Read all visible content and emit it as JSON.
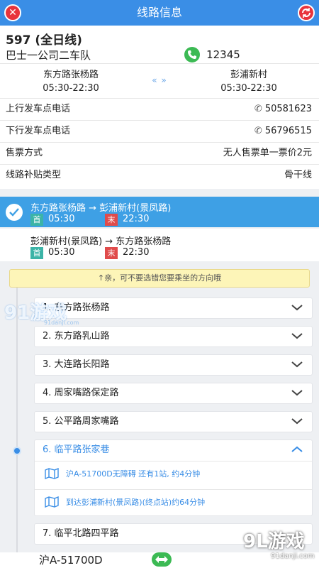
{
  "header": {
    "title": "线路信息"
  },
  "route": {
    "number": "597 (全日线)",
    "company": "巴士一公司二车队",
    "phone": "12345"
  },
  "terminals": {
    "left": {
      "name": "东方路张杨路",
      "hours": "05:30-22:30"
    },
    "right": {
      "name": "彭浦新村",
      "hours": "05:30-22:30"
    },
    "swap_symbol": "«  »"
  },
  "details": [
    {
      "label": "上行发车点电话",
      "value": "50581623"
    },
    {
      "label": "下行发车点电话",
      "value": "56796515"
    },
    {
      "label": "售票方式",
      "value": "无人售票单一票价2元"
    },
    {
      "label": "线路补贴类型",
      "value": "骨干线"
    }
  ],
  "directions": [
    {
      "title": "东方路张杨路 → 彭浦新村(景凤路)",
      "start_badge": "首",
      "start_time": "05:30",
      "end_badge": "末",
      "end_time": "22:30",
      "selected": true
    },
    {
      "title": "彭浦新村(景凤路) → 东方路张杨路",
      "start_badge": "首",
      "start_time": "05:30",
      "end_badge": "末",
      "end_time": "22:30",
      "selected": false
    }
  ],
  "notice": "↑亲，可不要选错您要乘坐的方向哦",
  "stops": [
    {
      "label": "1. 东方路张杨路"
    },
    {
      "label": "2. 东方路乳山路"
    },
    {
      "label": "3. 大连路长阳路"
    },
    {
      "label": "4. 周家嘴路保定路"
    },
    {
      "label": "5. 公平路周家嘴路"
    },
    {
      "label": "6. 临平路张家巷",
      "expanded": true
    },
    {
      "label": "7. 临平北路四平路"
    }
  ],
  "arrival": {
    "bus_info": "沪A-51700D无障碍 还有1站, 约4分钟",
    "terminal_info": "到达彭浦新村(景凤路)(终点站)约64分钟"
  },
  "bottom": {
    "plate": "沪A-51700D"
  },
  "watermarks": {
    "top_logo": "91游戏",
    "top_url": "91danji.com",
    "bottom_logo": "9L游戏",
    "bottom_url": "91danji.com"
  },
  "colors": {
    "header": "#3a8ee6",
    "selected_direction": "#3ea0e5",
    "start_badge": "#3cb4a7",
    "end_badge": "#e04b4b",
    "phone_green": "#3cba54",
    "notice_bg": "#fdf5b8"
  }
}
